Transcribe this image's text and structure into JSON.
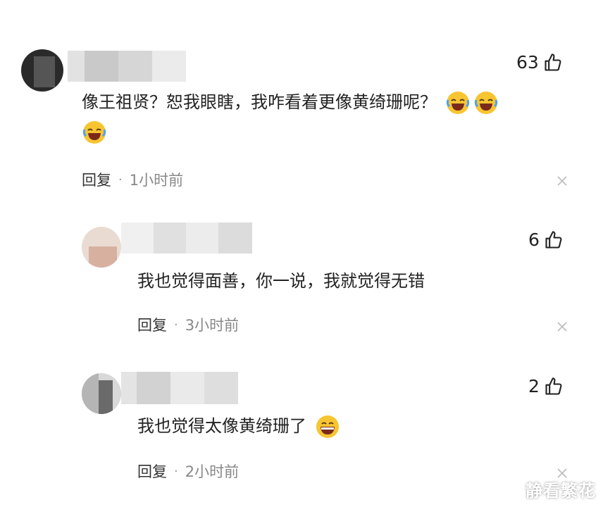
{
  "comments": [
    {
      "likes": "63",
      "text_line1": "像王祖贤？恕我眼瞎，我咋看着更像黄绮珊呢？",
      "reply_label": "回复",
      "separator": "·",
      "time": "1小时前",
      "emojis": [
        "laugh-cry-emoji",
        "laugh-cry-emoji",
        "laugh-cry-emoji"
      ]
    },
    {
      "likes": "6",
      "text_line1": "我也觉得面善，你一说，我就觉得无错",
      "reply_label": "回复",
      "separator": "·",
      "time": "3小时前"
    },
    {
      "likes": "2",
      "text_line1": "我也觉得太像黄绮珊了",
      "reply_label": "回复",
      "separator": "·",
      "time": "2小时前",
      "emojis": [
        "grin-emoji"
      ]
    }
  ],
  "watermark": "静看繁花",
  "colors": {
    "like_icon": "#222222",
    "close_icon": "#bbbbbb",
    "emoji_yellow": "#f7c531"
  }
}
